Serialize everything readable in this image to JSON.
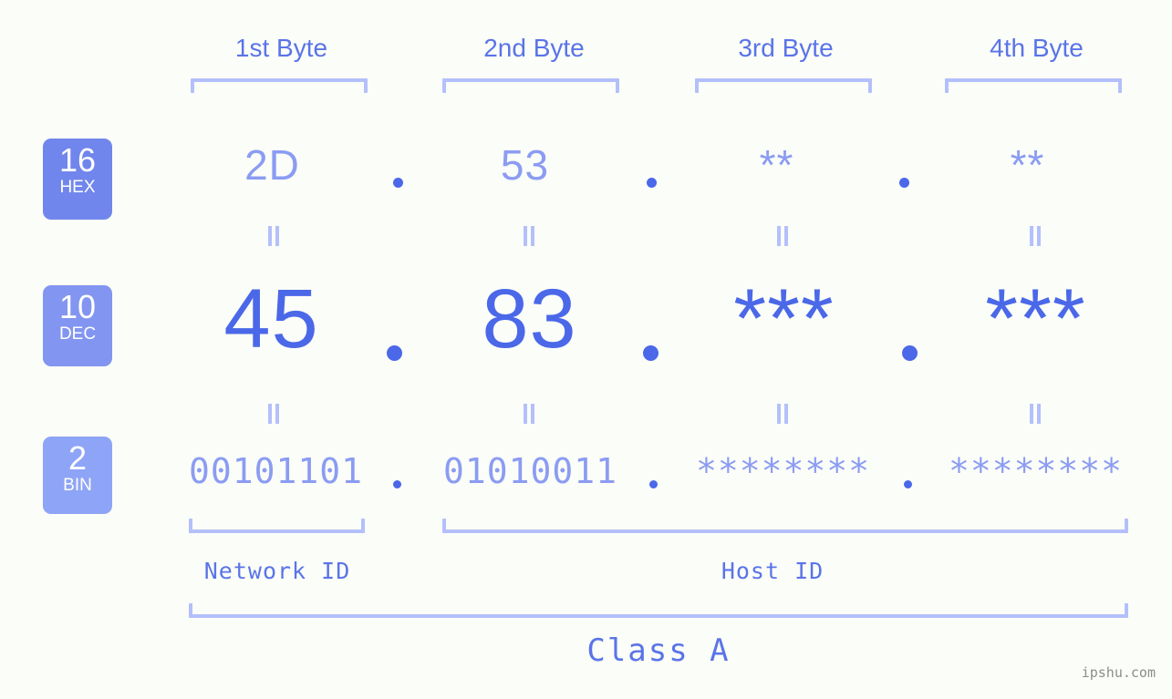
{
  "meta": {
    "site_watermark": "ipshu.com",
    "background_color": "#fbfdf8",
    "accent_strong": "#4a68e8",
    "accent_mid": "#5a74e8",
    "accent_light": "#8b9cf2",
    "bracket_color": "#b4c0fb"
  },
  "byte_headers": [
    {
      "label": "1st Byte"
    },
    {
      "label": "2nd Byte"
    },
    {
      "label": "3rd Byte"
    },
    {
      "label": "4th Byte"
    }
  ],
  "bases": [
    {
      "number": "16",
      "name": "HEX",
      "color": "#7186ec"
    },
    {
      "number": "10",
      "name": "DEC",
      "color": "#8295f0"
    },
    {
      "number": "2",
      "name": "BIN",
      "color": "#8ea4f6"
    }
  ],
  "rows": {
    "hex": {
      "base_number": "16",
      "base_name": "HEX",
      "values": [
        "2D",
        "53",
        "**",
        "**"
      ],
      "separator": "."
    },
    "dec": {
      "base_number": "10",
      "base_name": "DEC",
      "values": [
        "45",
        "83",
        "***",
        "***"
      ],
      "separator": "."
    },
    "bin": {
      "base_number": "2",
      "base_name": "BIN",
      "values": [
        "00101101",
        "01010011",
        "********",
        "********"
      ],
      "separator": "."
    }
  },
  "equals_symbol": "=",
  "sections": {
    "network_id": "Network ID",
    "host_id": "Host ID",
    "class": "Class A"
  }
}
